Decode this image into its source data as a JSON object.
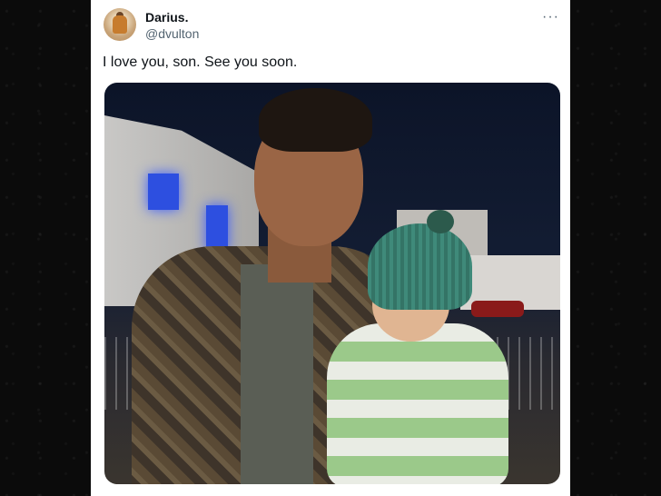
{
  "post": {
    "display_name": "Darius.",
    "handle": "@dvulton",
    "more_label": "···",
    "text": "I love you, son. See you soon."
  },
  "icons": {
    "more": "more-options-icon"
  },
  "colors": {
    "text_primary": "#0f1419",
    "text_secondary": "#536471",
    "background": "#0b0b0b",
    "card": "#ffffff"
  }
}
